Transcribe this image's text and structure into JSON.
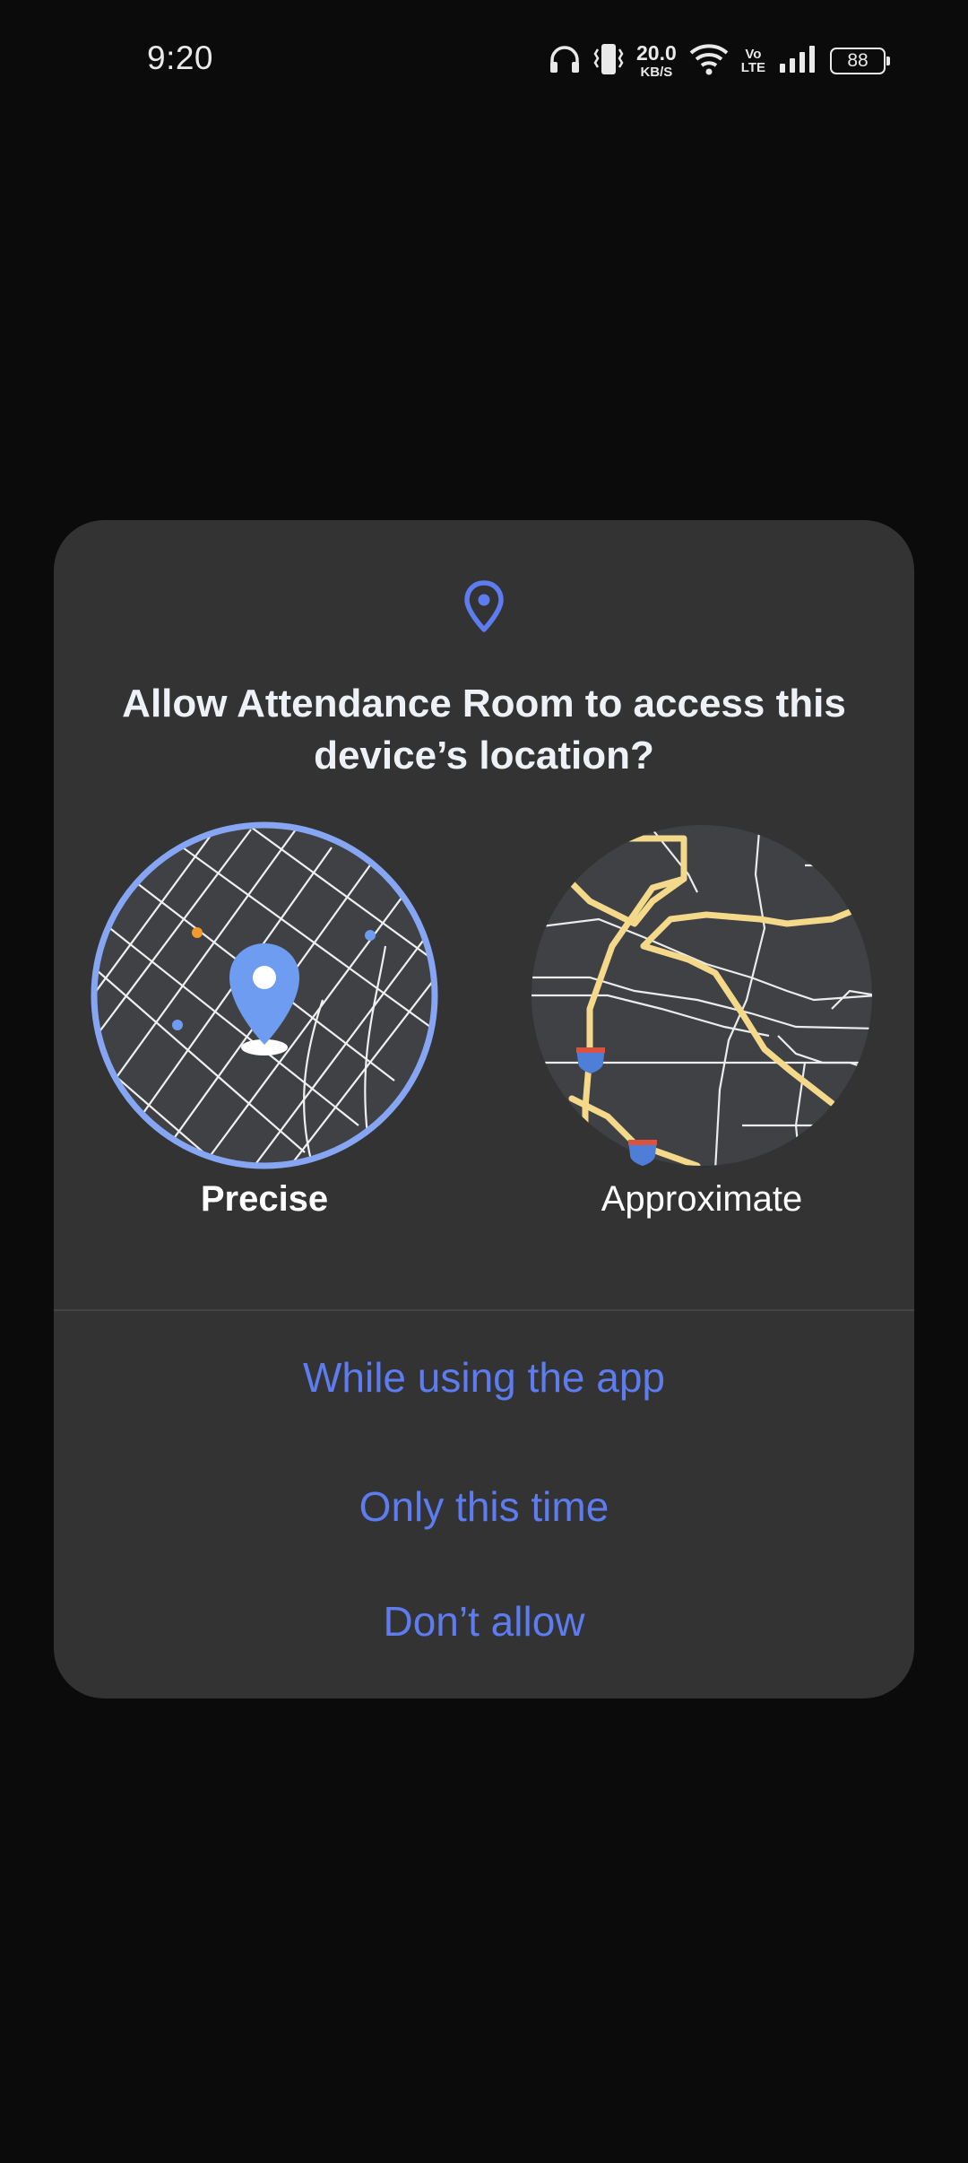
{
  "status_bar": {
    "time": "9:20",
    "net_speed_value": "20.0",
    "net_speed_unit": "KB/S",
    "volte_top": "Vo",
    "volte_bottom": "LTE",
    "battery_level": "88",
    "icons": [
      "headphones-icon",
      "vibrate-icon",
      "wifi-icon",
      "volte-icon",
      "signal-icon",
      "battery-icon"
    ]
  },
  "dialog": {
    "icon": "location-pin-icon",
    "title": "Allow Attendance Room to access this device’s location?",
    "options": [
      {
        "label": "Precise",
        "selected": true
      },
      {
        "label": "Approximate",
        "selected": false
      }
    ],
    "actions": [
      {
        "label": "While using the app"
      },
      {
        "label": "Only this time"
      },
      {
        "label": "Don’t allow"
      }
    ]
  },
  "colors": {
    "background": "#0b0b0c",
    "dialog": "#333334",
    "accent": "#5c7cf0",
    "map_bg": "#3f4144",
    "precise_ring": "#86a6f4",
    "pin": "#6d9cf0",
    "roads_major": "#f5d98a"
  }
}
